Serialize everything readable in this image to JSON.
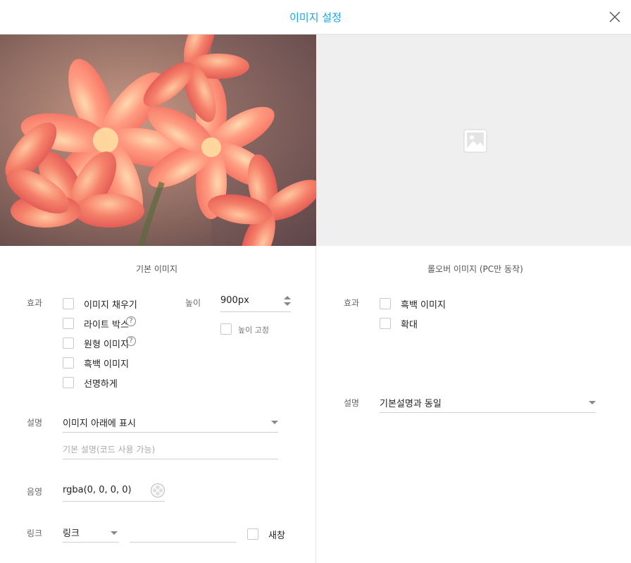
{
  "dialog": {
    "title": "이미지 설정"
  },
  "basic": {
    "section_title": "기본 이미지",
    "effect_label": "효과",
    "effects": [
      "이미지 채우기",
      "라이트 박스",
      "원형 이미지",
      "흑백 이미지",
      "선명하게"
    ],
    "height_label": "높이",
    "height_value": "900px",
    "fix_height_label": "높이 고정",
    "desc_label": "설명",
    "desc_select": "이미지 아래에 표시",
    "desc_placeholder": "기본 설명(코드 사용 가능)",
    "shadow_label": "음영",
    "shadow_value": "rgba(0, 0, 0, 0)",
    "link_label": "링크",
    "link_select": "링크",
    "link_value": "",
    "new_window_label": "새창"
  },
  "rollover": {
    "section_title": "롤오버 이미지 (PC만 동작)",
    "effect_label": "효과",
    "effects": [
      "흑백 이미지",
      "확대"
    ],
    "desc_label": "설명",
    "desc_select": "기본설명과 동일"
  },
  "colors": {
    "accent": "#1aa3e8",
    "placeholder_bg": "#efefef"
  },
  "icons": {
    "close": "close-icon",
    "help": "question-icon",
    "image_placeholder": "image-icon",
    "color_picker": "palette-icon"
  }
}
